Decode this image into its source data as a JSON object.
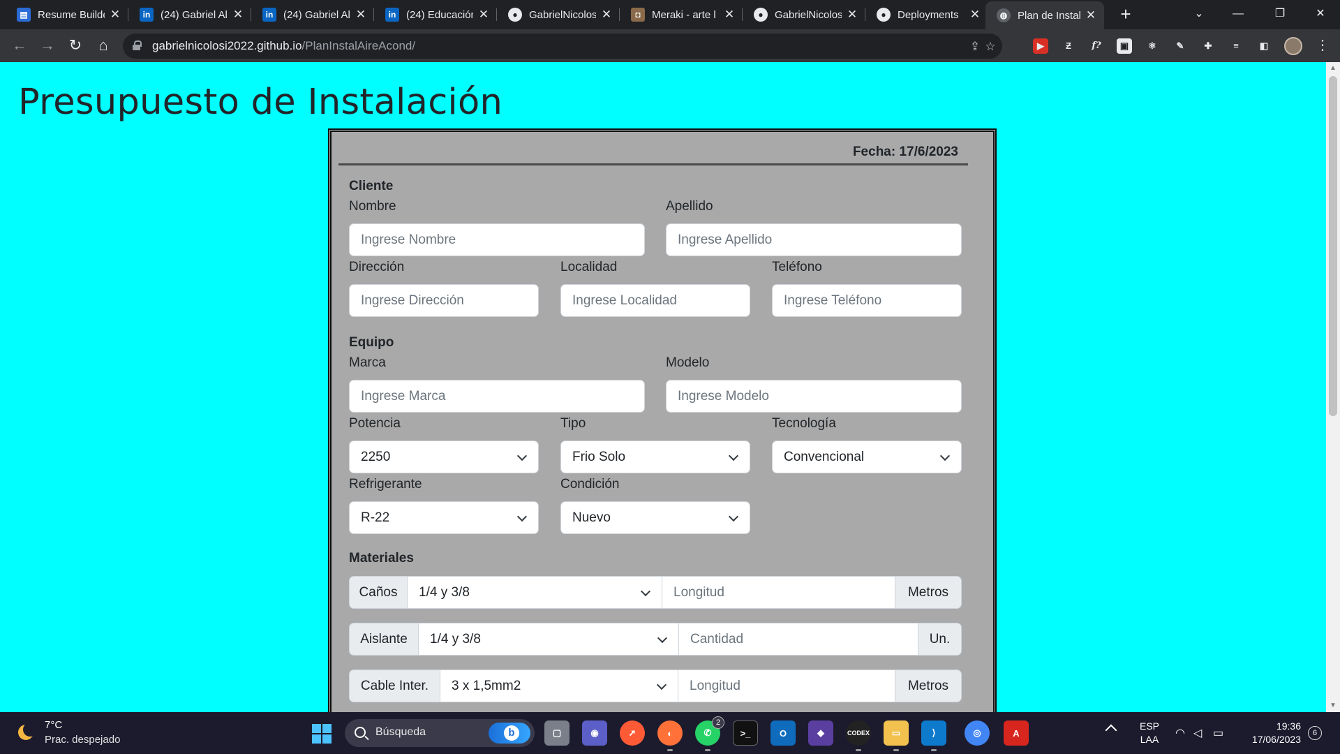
{
  "browser": {
    "tabs": [
      {
        "title": "Resume Builde",
        "icon": "resume-builder-icon",
        "color": "#2b6cd6",
        "glyph": "▤"
      },
      {
        "title": "(24) Gabriel Al",
        "icon": "linkedin-icon",
        "color": "#0a66c2",
        "glyph": "in"
      },
      {
        "title": "(24) Gabriel Al",
        "icon": "linkedin-icon",
        "color": "#0a66c2",
        "glyph": "in"
      },
      {
        "title": "(24) Educación",
        "icon": "linkedin-icon",
        "color": "#0a66c2",
        "glyph": "in"
      },
      {
        "title": "GabrielNicolos",
        "icon": "github-icon",
        "color": "#202124",
        "glyph": "●"
      },
      {
        "title": "Meraki - arte l",
        "icon": "meraki-icon",
        "color": "#8a6a4a",
        "glyph": "◘"
      },
      {
        "title": "GabrielNicolos",
        "icon": "github-icon",
        "color": "#202124",
        "glyph": "●"
      },
      {
        "title": "Deployments",
        "icon": "github-icon",
        "color": "#202124",
        "glyph": "●"
      },
      {
        "title": "Plan de Instala",
        "icon": "globe-icon",
        "color": "#5f6368",
        "glyph": "◍",
        "active": true
      }
    ],
    "address": {
      "host": "gabrielnicolosi2022.github.io",
      "path": "/PlanInstalAireAcond/"
    }
  },
  "page": {
    "title": "Presupuesto de Instalación",
    "fecha": "Fecha: 17/6/2023",
    "cliente": {
      "heading": "Cliente",
      "nombre_label": "Nombre",
      "nombre_placeholder": "Ingrese Nombre",
      "apellido_label": "Apellido",
      "apellido_placeholder": "Ingrese Apellido",
      "direccion_label": "Dirección",
      "direccion_placeholder": "Ingrese Dirección",
      "localidad_label": "Localidad",
      "localidad_placeholder": "Ingrese Localidad",
      "telefono_label": "Teléfono",
      "telefono_placeholder": "Ingrese Teléfono"
    },
    "equipo": {
      "heading": "Equipo",
      "marca_label": "Marca",
      "marca_placeholder": "Ingrese Marca",
      "modelo_label": "Modelo",
      "modelo_placeholder": "Ingrese Modelo",
      "potencia_label": "Potencia",
      "potencia_value": "2250",
      "tipo_label": "Tipo",
      "tipo_value": "Frio Solo",
      "tecnologia_label": "Tecnología",
      "tecnologia_value": "Convencional",
      "refrigerante_label": "Refrigerante",
      "refrigerante_value": "R-22",
      "condicion_label": "Condición",
      "condicion_value": "Nuevo"
    },
    "materiales": {
      "heading": "Materiales",
      "rows": [
        {
          "label": "Caños",
          "select": "1/4 y 3/8",
          "placeholder": "Longitud",
          "unit": "Metros"
        },
        {
          "label": "Aislante",
          "select": "1/4 y 3/8",
          "placeholder": "Cantidad",
          "unit": "Un."
        },
        {
          "label": "Cable Inter.",
          "select": "3 x 1,5mm2",
          "placeholder": "Longitud",
          "unit": "Metros"
        }
      ]
    }
  },
  "taskbar": {
    "temp": "7°C",
    "weather": "Prac. despejado",
    "search": "Búsqueda",
    "whatsapp_badge": "2",
    "lang": "ESP",
    "layout": "LAA",
    "time": "19:36",
    "date": "17/06/2023",
    "notifications": "6"
  }
}
